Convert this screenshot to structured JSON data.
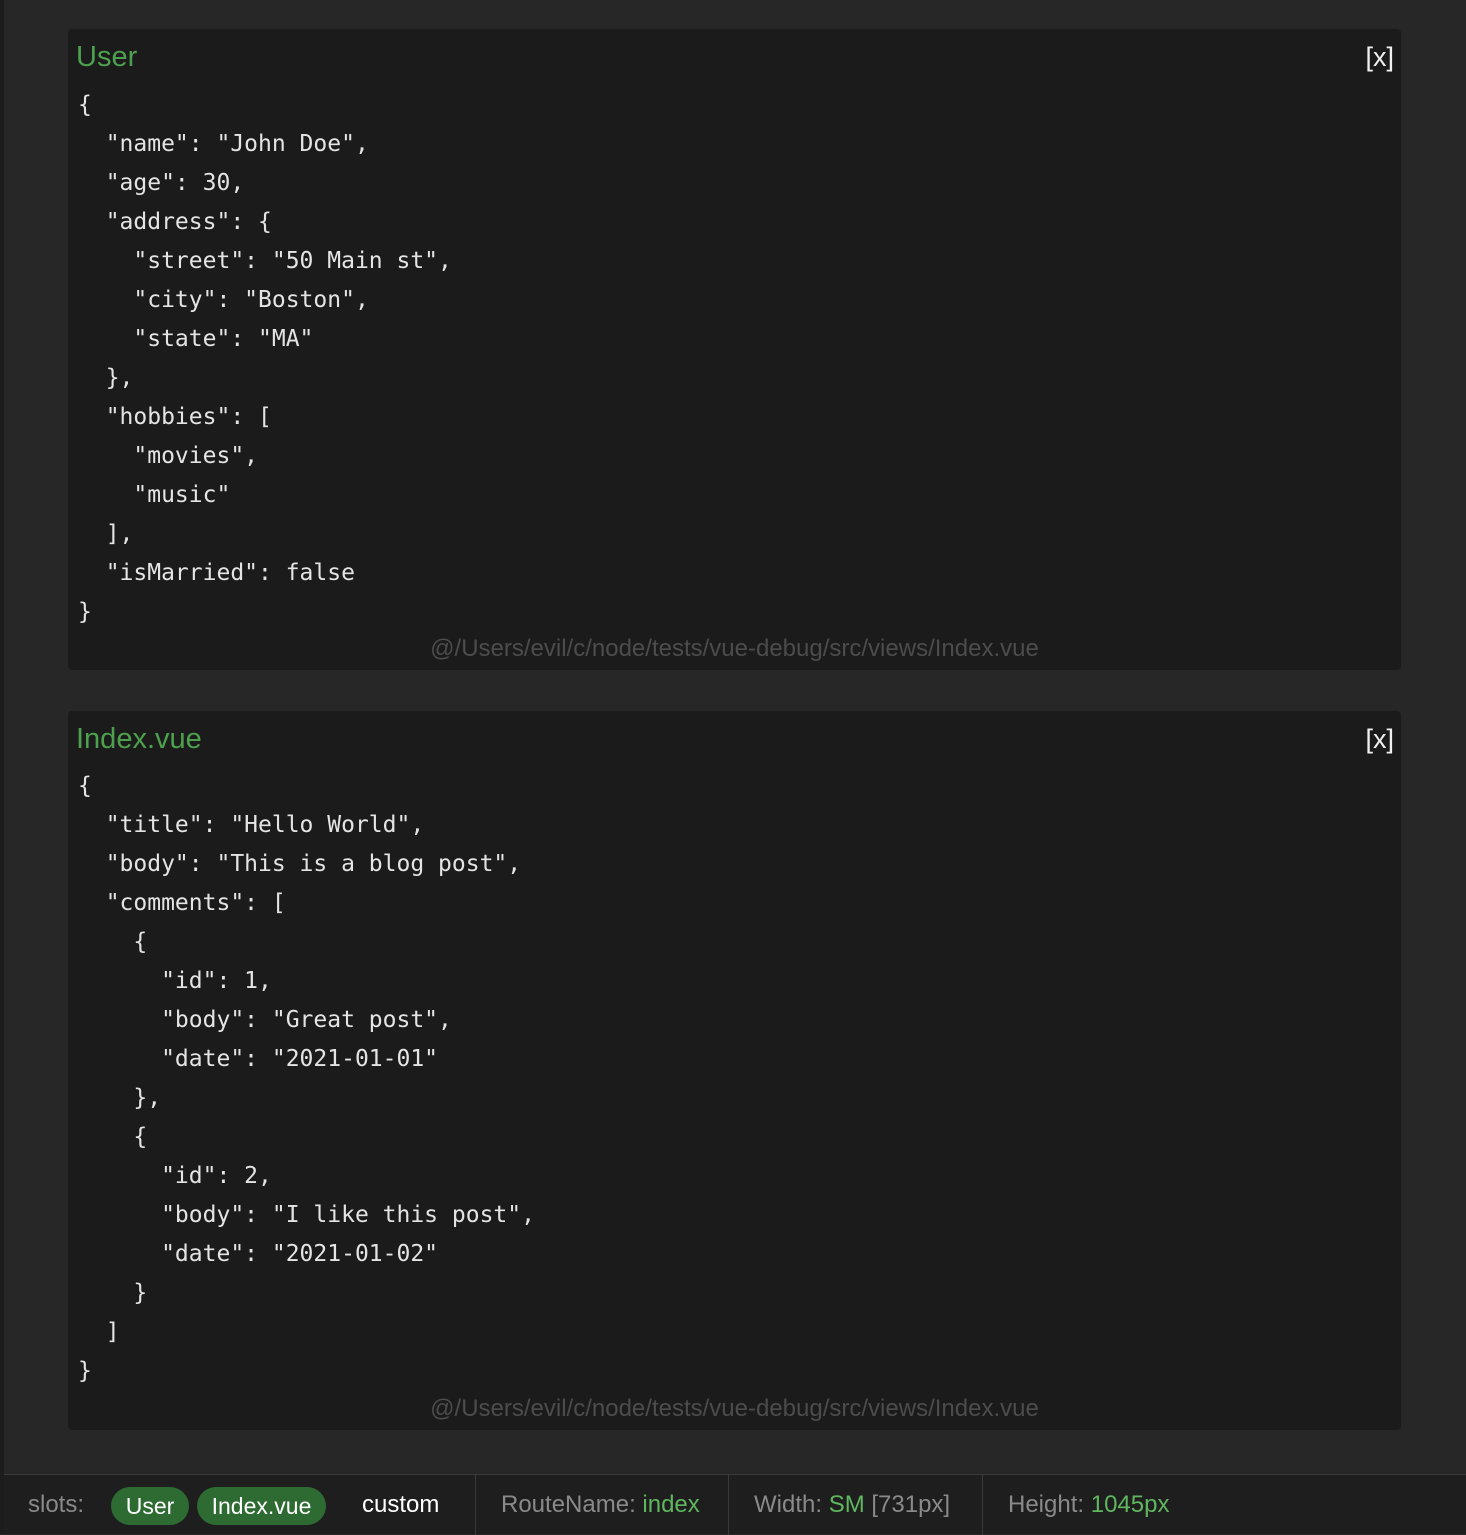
{
  "panels": [
    {
      "title": "User",
      "close_label": "[x]",
      "json": "{\n  \"name\": \"John Doe\",\n  \"age\": 30,\n  \"address\": {\n    \"street\": \"50 Main st\",\n    \"city\": \"Boston\",\n    \"state\": \"MA\"\n  },\n  \"hobbies\": [\n    \"movies\",\n    \"music\"\n  ],\n  \"isMarried\": false\n}",
      "path": "@/Users/evil/c/node/tests/vue-debug/src/views/Index.vue"
    },
    {
      "title": "Index.vue",
      "close_label": "[x]",
      "json": "{\n  \"title\": \"Hello World\",\n  \"body\": \"This is a blog post\",\n  \"comments\": [\n    {\n      \"id\": 1,\n      \"body\": \"Great post\",\n      \"date\": \"2021-01-01\"\n    },\n    {\n      \"id\": 2,\n      \"body\": \"I like this post\",\n      \"date\": \"2021-01-02\"\n    }\n  ]\n}",
      "path": "@/Users/evil/c/node/tests/vue-debug/src/views/Index.vue"
    }
  ],
  "status_bar": {
    "slots_label": "slots:",
    "slots": [
      "User",
      "Index.vue"
    ],
    "custom_label": "custom",
    "route_label": "RouteName:",
    "route_value": "index",
    "width_label": "Width:",
    "width_breakpoint": "SM",
    "width_px": "[731px]",
    "height_label": "Height:",
    "height_value": "1045px"
  },
  "colors": {
    "accent_green": "#4da04d",
    "chip_bg": "#2e6b33",
    "panel_bg": "#1b1b1b",
    "page_bg": "#272727"
  }
}
